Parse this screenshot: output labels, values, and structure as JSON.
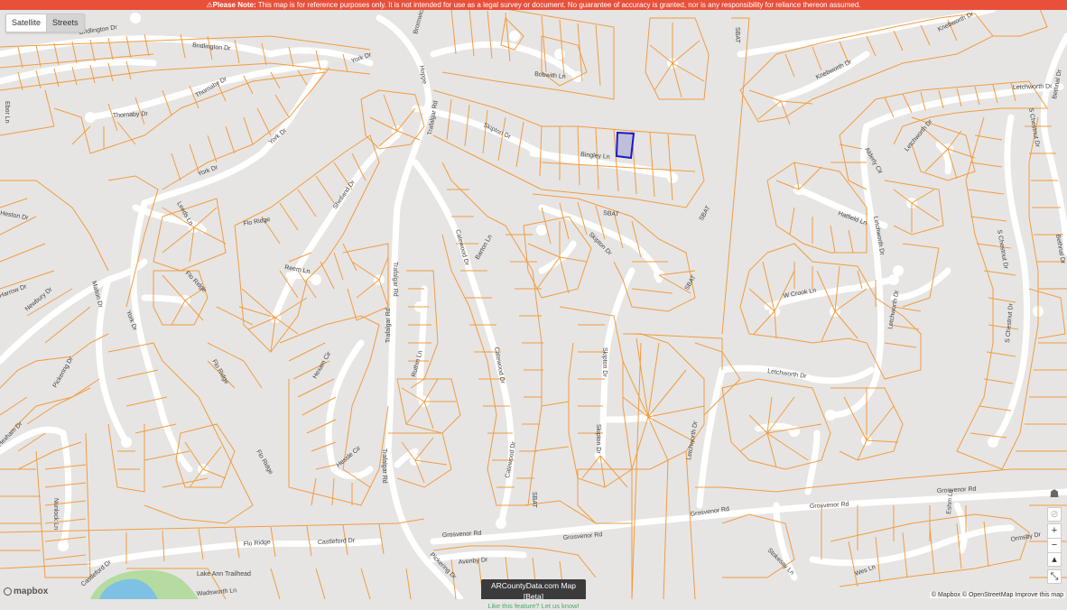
{
  "banner": {
    "label": "Please Note:",
    "text": " This map is for reference purposes only. It is not intended for use as a legal survey or document. No guarantee of accuracy is granted, nor is any responsibility for reliance thereon assumed.",
    "color": "#e8503a"
  },
  "toggle": {
    "satellite": "Satellite",
    "streets": "Streets",
    "active": "Streets"
  },
  "colors": {
    "parcel": "#f39c40",
    "road": "#ffffff",
    "land": "#e6e5e3",
    "highlight": "#1a1ac8",
    "water": "#7ec1e4",
    "park": "#b5dba0"
  },
  "streets": {
    "bridlington_1": "Bridlington Dr",
    "bridlington_2": "Bridlington Dr",
    "york_1": "York Dr",
    "york_2": "York Dr",
    "york_3": "York Dr",
    "york_4": "York Dr",
    "thornaby_1": "Thornaby Dr",
    "thornaby_2": "Thornaby Dr",
    "bromwich": "Bromwich",
    "trafalgar_1": "Trafalgar Rd",
    "trafalgar_2": "Trafalgar Rd",
    "trafalgar_3": "Trafalgar Rd",
    "trafalgar_4": "Trafalgar Rd",
    "hoppe": "Hoppe",
    "bobwith": "Bobwith Ln",
    "skipton_1": "Skipton Dr",
    "skipton_2": "Skipton Dr",
    "skipton_3": "Skipton Dr",
    "skipton_4": "Skipton Dr",
    "bingley": "Bingley Ln",
    "sbat_1": "SBAT",
    "sbat_2": "SBAT",
    "sbat_3": "SBAT",
    "sbat_4": "SBAT",
    "sbat_5": "SBAT",
    "knebworth_1": "Knebworth Dr",
    "knebworth_2": "Knebworth Dr",
    "letchworth_1": "Letchworth Dr",
    "letchworth_2": "Letchworth Dr",
    "letchworth_3": "Letchworth Dr",
    "letchworth_4": "Letchworth Dr",
    "letchworth_5": "Letchworth Dr",
    "letchworth_6": "Letchworth Dr",
    "schestnut_1": "S Chestnut Dr",
    "schestnut_2": "S Chestnut Dr",
    "schestnut_3": "S Chestnut Dr",
    "bethnal_1": "Bethnal Dr",
    "bethnal_2": "Bethnal Dr",
    "alderly": "Alderly Cir",
    "hatfield": "Hatfield Ln",
    "wcrook": "W Crook Ln",
    "ebor": "Ebor Ln",
    "leeds": "Leeds Ln",
    "heston": "Heston Dr",
    "flo_ridge_1": "Flo Ridge",
    "flo_ridge_2": "Flo Ridge",
    "flo_ridge_3": "Flo Ridge",
    "flo_ridge_4": "Flo Ridge",
    "flo_ridge_5": "Flo Ridge",
    "shetland": "Shetland Dr",
    "reem": "Reem Ln",
    "malton": "Malton Dr",
    "newbury": "Newbury Dr",
    "pickering": "Pickering Dr",
    "catewood_1": "Catewood Dr",
    "catewood_2": "Catewood Dr",
    "catewood_3": "Catewood Dr",
    "harrow": "Harrow Dr",
    "nunlock": "Nunlock Ln",
    "hexham": "Hexham Dr",
    "hexam_cir": "Hexam Cir",
    "hessle": "Hessle Cir",
    "ruthin": "Ruthin Ln",
    "grosvenor_1": "Grosvenor Rd",
    "grosvenor_2": "Grosvenor Rd",
    "grosvenor_3": "Grosvenor Rd",
    "grosvenor_4": "Grosvenor Rd",
    "grosvenor_5": "Grosvenor Rd",
    "castleford": "Castleford Dr",
    "castleford_2": "Castleford Dr",
    "lake_ann": "Lake Ann Trailhead",
    "wadsworth": "Wadsworth Ln",
    "avenby": "Avenby Dr",
    "pickering_2": "Pickering Dr",
    "stokesay": "Stokesay Ln",
    "wes": "Wes Ln",
    "eshm": "Eshm Ln",
    "bartonl": "Barton Ln",
    "ormsby": "Ormsby Dr"
  },
  "controls": {
    "zoom_in": "+",
    "zoom_out": "−",
    "compass": "▴",
    "fullscreen": "⤡",
    "locate": "⊘",
    "pegman": "☗"
  },
  "attribution": "© Mapbox © OpenStreetMap Improve this map",
  "logo": "mapbox",
  "beta": {
    "title": "ARCountyData.com Map [Beta]",
    "link": "Like this feature? Let us know!"
  }
}
